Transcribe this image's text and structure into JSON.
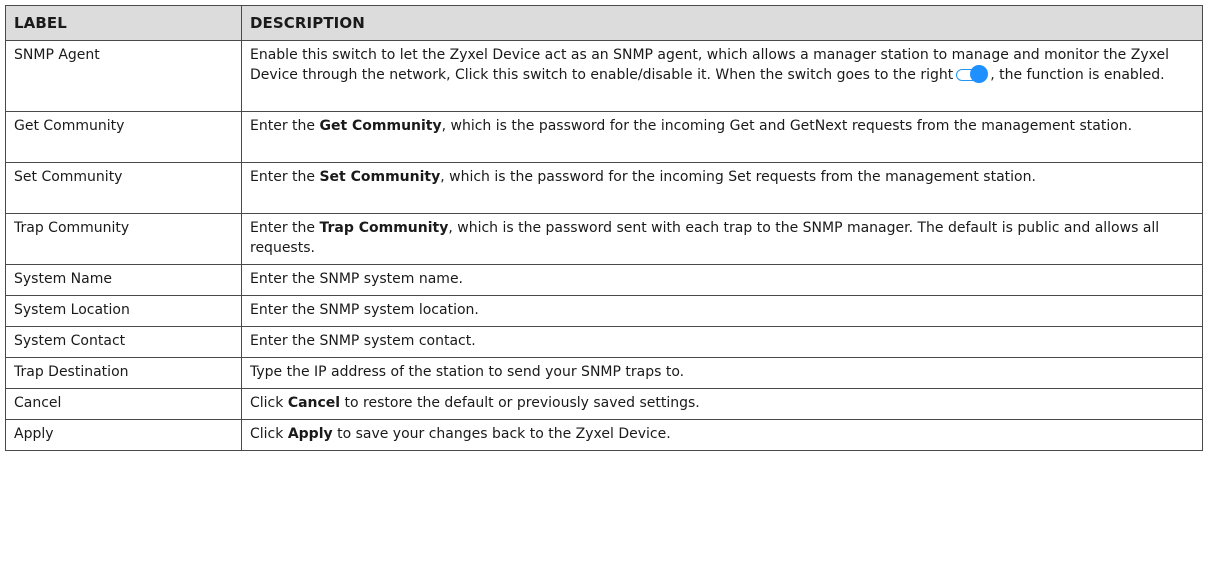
{
  "table": {
    "headers": {
      "label": "LABEL",
      "description": "DESCRIPTION"
    },
    "rows": [
      {
        "label": "SNMP Agent",
        "desc": {
          "line1": "Enable this switch to let the Zyxel Device act as an SNMP agent, which allows a manager station to manage and monitor the Zyxel Device through the network, Click this switch to enable/disable it. When the switch goes to the right",
          "toggle_icon": "toggle-switch-on-icon",
          "line2": ", the function is enabled."
        }
      },
      {
        "label": "Get Community",
        "desc": {
          "pre": "Enter the ",
          "bold": "Get Community",
          "post": ", which is the password for the incoming Get and GetNext requests from the management station."
        }
      },
      {
        "label": "Set Community",
        "desc": {
          "pre": "Enter the ",
          "bold": "Set Community",
          "post": ", which is the password for the incoming Set requests from the management station."
        }
      },
      {
        "label": "Trap Community",
        "desc": {
          "pre": "Enter the ",
          "bold": "Trap Community",
          "post": ", which is the password sent with each trap to the SNMP manager. The default is public and allows all requests."
        }
      },
      {
        "label": "System Name",
        "desc": {
          "text": "Enter the SNMP system name."
        }
      },
      {
        "label": "System Location",
        "desc": {
          "text": "Enter the SNMP system location."
        }
      },
      {
        "label": "System Contact",
        "desc": {
          "text": "Enter the SNMP system contact."
        }
      },
      {
        "label": "Trap Destination",
        "desc": {
          "text": "Type the IP address of the station to send your SNMP traps to."
        }
      },
      {
        "label": "Cancel",
        "desc": {
          "pre": "Click ",
          "bold": "Cancel",
          "post": " to restore the default or previously saved settings."
        }
      },
      {
        "label": "Apply",
        "desc": {
          "pre": "Click ",
          "bold": "Apply",
          "post": " to save your changes back to the Zyxel Device."
        }
      }
    ]
  },
  "colors": {
    "header_bg": "#dcdcdc",
    "border": "#4a4a4a",
    "toggle_accent": "#1e90ff"
  }
}
